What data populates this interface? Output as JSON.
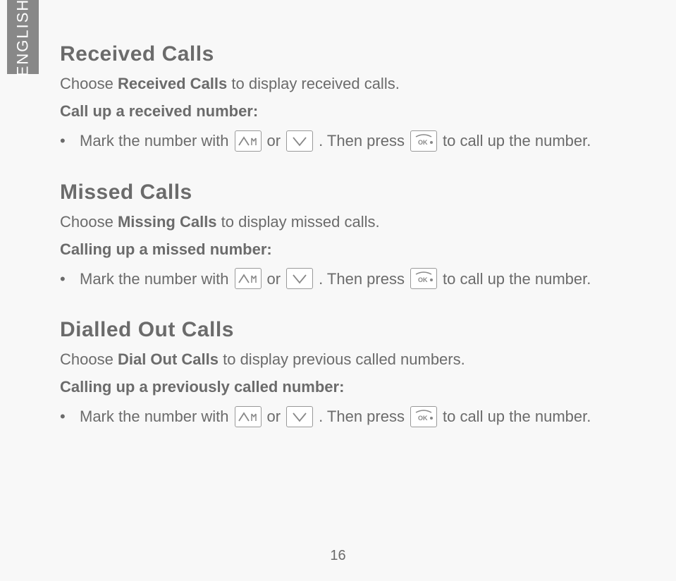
{
  "sideTab": "ENGLISH",
  "sections": {
    "received": {
      "heading": "Received Calls",
      "choose_pre": "Choose ",
      "choose_bold": "Received Calls",
      "choose_post": " to display received calls.",
      "callUp": "Call up a received number:",
      "mark": "Mark the number with",
      "or": "or",
      "thenPress": ". Then press",
      "tail": "to call up the number."
    },
    "missed": {
      "heading": "Missed Calls",
      "choose_pre": "Choose ",
      "choose_bold": "Missing Calls",
      "choose_post": " to display missed calls.",
      "callUp": "Calling up a missed number:",
      "mark": "Mark the number with",
      "or": "or",
      "thenPress": ". Then press",
      "tail": "to call up the number."
    },
    "dialled": {
      "heading": "Dialled Out Calls",
      "choose_pre": "Choose ",
      "choose_bold": "Dial Out Calls",
      "choose_post": " to display previous called numbers.",
      "callUp": "Calling up a previously called number:",
      "mark": "Mark the number with",
      "or": "or",
      "thenPress": ". Then press",
      "tail": "to call up the number."
    }
  },
  "pageNumber": "16"
}
